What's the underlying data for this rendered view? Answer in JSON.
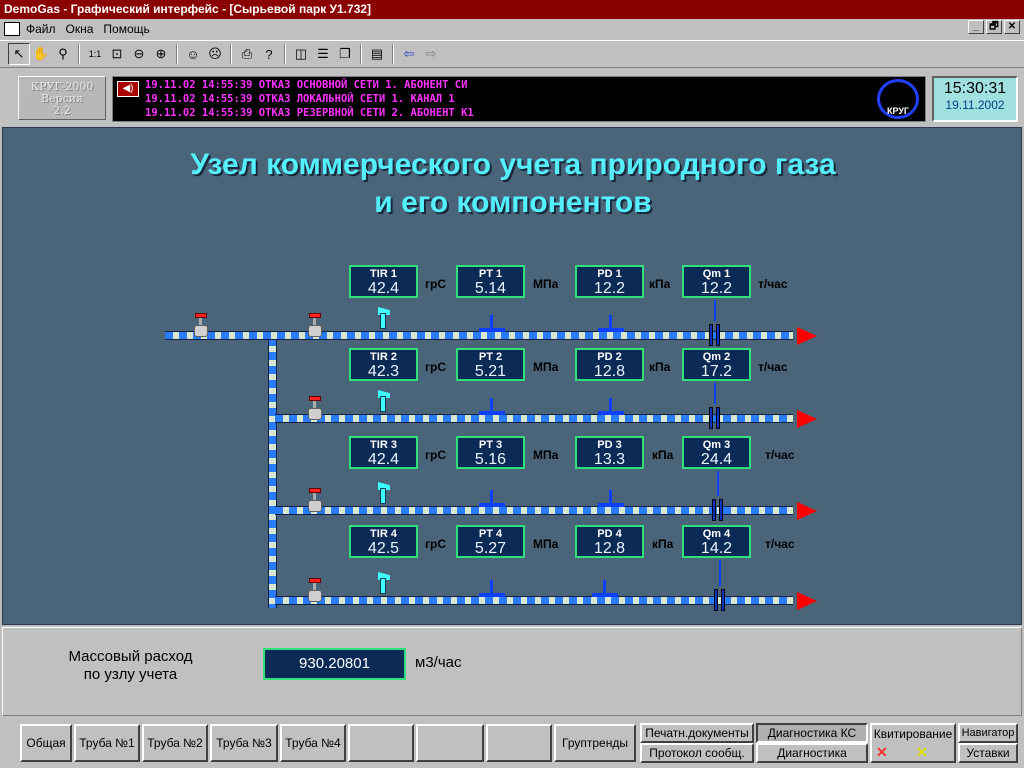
{
  "window": {
    "title": "DemoGas - Графический интерфейс - [Сырьевой парк У1.732]"
  },
  "menu": [
    "Файл",
    "Окна",
    "Помощь"
  ],
  "window_controls": [
    "_",
    "🗗",
    "✕"
  ],
  "toolbar_icons": [
    "pointer-icon",
    "hand-icon",
    "magnifier-icon",
    "zoom-1-1-icon",
    "zoom-fit-icon",
    "zoom-out-icon",
    "zoom-in-icon",
    "operator-icon",
    "operator-remove-icon",
    "print-icon",
    "help-icon",
    "layout-vertical-icon",
    "layout-horizontal-icon",
    "cascade-icon",
    "window-list-icon",
    "back-arrow-icon",
    "forward-arrow-icon"
  ],
  "logo": {
    "line1": "КРУГ-2000",
    "line2": "Версия",
    "line3": "2.2"
  },
  "alarms": [
    "19.11.02 14:55:39  ОТКАЗ ОСНОВНОЙ СЕТИ 1. АБОНЕНТ СИ",
    "19.11.02 14:55:39  ОТКАЗ ЛОКАЛЬНОЙ СЕТИ 1. КАНАЛ 1",
    "19.11.02 14:55:39  ОТКАЗ РЕЗЕРВНОЙ СЕТИ 2. АБОНЕНТ К1"
  ],
  "krug_logo": "КРУГ",
  "clock": {
    "time": "15:30:31",
    "date": "19.11.2002"
  },
  "title": {
    "line1": "Узел коммерческого учета природного газа",
    "line2": "и его компонентов"
  },
  "pipes": [
    {
      "tir": {
        "label": "TIR 1",
        "value": "42.4",
        "unit": "грС"
      },
      "pt": {
        "label": "PT 1",
        "value": "5.14",
        "unit": "МПа"
      },
      "pd": {
        "label": "PD 1",
        "value": "12.2",
        "unit": "кПа"
      },
      "qm": {
        "label": "Qm 1",
        "value": "12.2",
        "unit": "т/час"
      }
    },
    {
      "tir": {
        "label": "TIR 2",
        "value": "42.3",
        "unit": "грС"
      },
      "pt": {
        "label": "PT 2",
        "value": "5.21",
        "unit": "МПа"
      },
      "pd": {
        "label": "PD 2",
        "value": "12.8",
        "unit": "кПа"
      },
      "qm": {
        "label": "Qm 2",
        "value": "17.2",
        "unit": "т/час"
      }
    },
    {
      "tir": {
        "label": "TIR 3",
        "value": "42.4",
        "unit": "грС"
      },
      "pt": {
        "label": "PT 3",
        "value": "5.16",
        "unit": "МПа"
      },
      "pd": {
        "label": "PD 3",
        "value": "13.3",
        "unit": "кПа"
      },
      "qm": {
        "label": "Qm 3",
        "value": "24.4",
        "unit": "т/час"
      }
    },
    {
      "tir": {
        "label": "TIR 4",
        "value": "42.5",
        "unit": "грС"
      },
      "pt": {
        "label": "PT 4",
        "value": "5.27",
        "unit": "МПа"
      },
      "pd": {
        "label": "PD 4",
        "value": "12.8",
        "unit": "кПа"
      },
      "qm": {
        "label": "Qm 4",
        "value": "14.2",
        "unit": "т/час"
      }
    }
  ],
  "mass": {
    "label_line1": "Массовый расход",
    "label_line2": "по узлу учета",
    "value": "930.20801",
    "unit": "м3/час"
  },
  "buttons": {
    "general": "Общая",
    "pipe1": "Труба №1",
    "pipe2": "Труба №2",
    "pipe3": "Труба №3",
    "pipe4": "Труба №4",
    "group_trends": "Груптренды",
    "print_docs": "Печатн.документы",
    "msg_log": "Протокол сообщ.",
    "diag_ks": "Диагностика КС",
    "diag": "Диагностика",
    "ack": "Квитирование",
    "navigator": "Навигатор",
    "settings": "Уставки"
  },
  "colors": {
    "panel_bg": "#4a6479",
    "title": "#55f0ff",
    "box_bg": "#0b2a55",
    "box_border": "#2fe07a",
    "alarm_text": "#ff33ff",
    "titlebar": "#8a0000"
  }
}
